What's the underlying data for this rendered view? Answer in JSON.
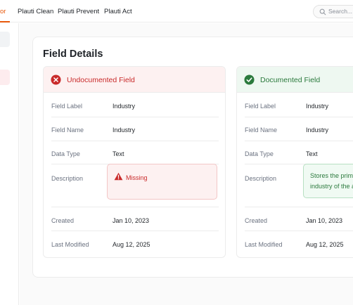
{
  "nav": {
    "tabs": [
      {
        "label": "or",
        "active": true
      },
      {
        "label": "Plauti Clean",
        "active": false
      },
      {
        "label": "Plauti Prevent",
        "active": false
      },
      {
        "label": "Plauti Act",
        "active": false
      }
    ],
    "accent_color": "#e8590c",
    "search": {
      "placeholder": "Search..."
    }
  },
  "panel": {
    "title": "Field Details"
  },
  "cards": {
    "undocumented": {
      "title": "Undocumented Field",
      "status_color": "#c92a2a",
      "icon": "x-circle-icon",
      "rows": {
        "field_label": {
          "label": "Field Label",
          "value": "Industry"
        },
        "field_name": {
          "label": "Field Name",
          "value": "Industry"
        },
        "data_type": {
          "label": "Data Type",
          "value": "Text"
        },
        "description": {
          "label": "Description",
          "value": "Missing",
          "icon": "warning-icon"
        },
        "created": {
          "label": "Created",
          "value": "Jan 10, 2023"
        },
        "last_modified": {
          "label": "Last Modified",
          "value": "Aug 12, 2025"
        }
      }
    },
    "documented": {
      "title": "Documented Field",
      "status_color": "#2b7a3d",
      "icon": "check-circle-icon",
      "rows": {
        "field_label": {
          "label": "Field Label",
          "value": "Industry"
        },
        "field_name": {
          "label": "Field Name",
          "value": "Industry"
        },
        "data_type": {
          "label": "Data Type",
          "value": "Text"
        },
        "description": {
          "label": "Description",
          "value": "Stores the primary industry of the account."
        },
        "created": {
          "label": "Created",
          "value": "Jan 10, 2023"
        },
        "last_modified": {
          "label": "Last Modified",
          "value": "Aug 12, 2025"
        }
      }
    }
  }
}
